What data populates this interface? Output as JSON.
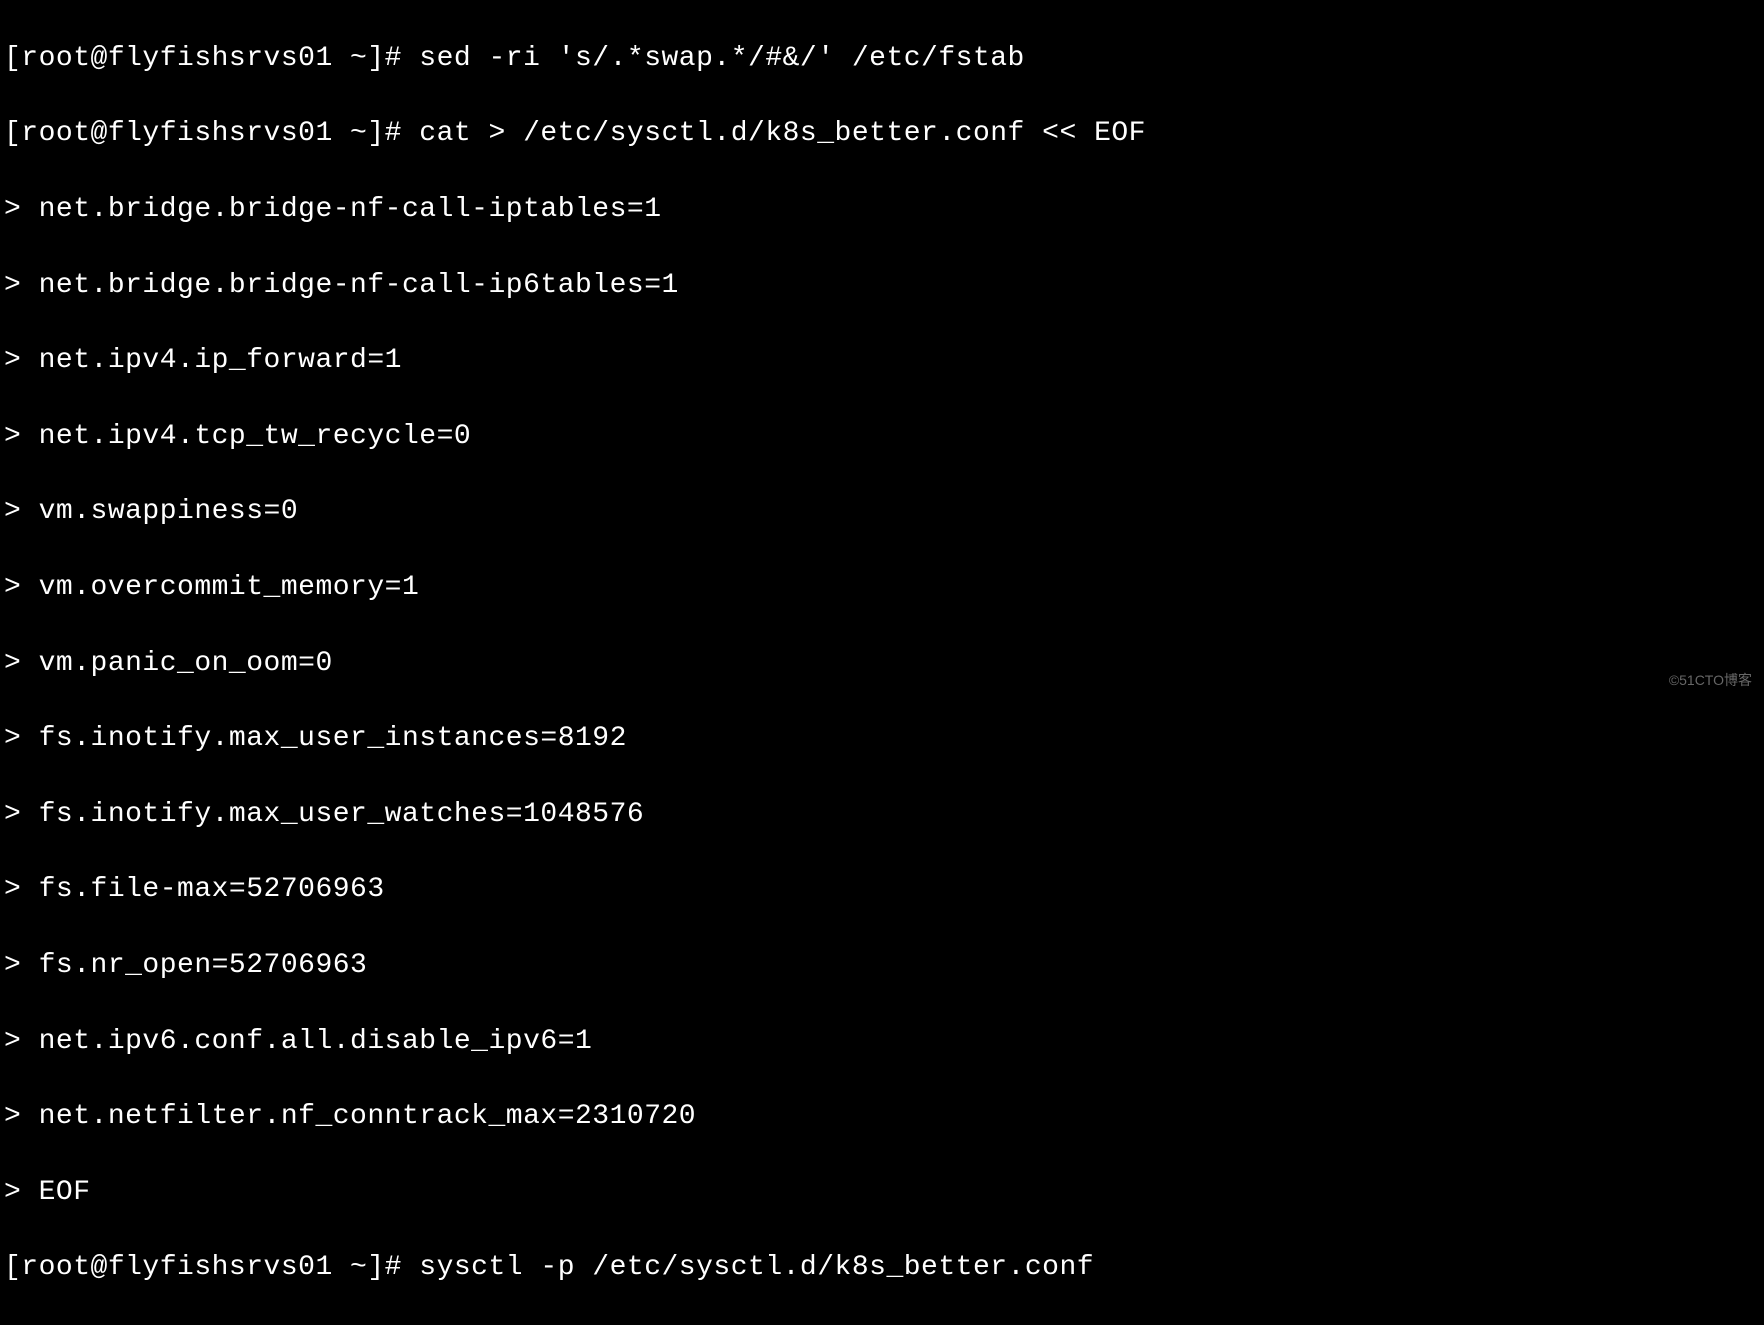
{
  "terminal": {
    "lines": [
      "[root@flyfishsrvs01 ~]# sed -ri 's/.*swap.*/#&/' /etc/fstab",
      "[root@flyfishsrvs01 ~]# cat > /etc/sysctl.d/k8s_better.conf << EOF",
      "> net.bridge.bridge-nf-call-iptables=1",
      "> net.bridge.bridge-nf-call-ip6tables=1",
      "> net.ipv4.ip_forward=1",
      "> net.ipv4.tcp_tw_recycle=0",
      "> vm.swappiness=0",
      "> vm.overcommit_memory=1",
      "> vm.panic_on_oom=0",
      "> fs.inotify.max_user_instances=8192",
      "> fs.inotify.max_user_watches=1048576",
      "> fs.file-max=52706963",
      "> fs.nr_open=52706963",
      "> net.ipv6.conf.all.disable_ipv6=1",
      "> net.netfilter.nf_conntrack_max=2310720",
      "> EOF",
      "[root@flyfishsrvs01 ~]# sysctl -p /etc/sysctl.d/k8s_better.conf"
    ]
  },
  "watermark": "©51CTO博客"
}
